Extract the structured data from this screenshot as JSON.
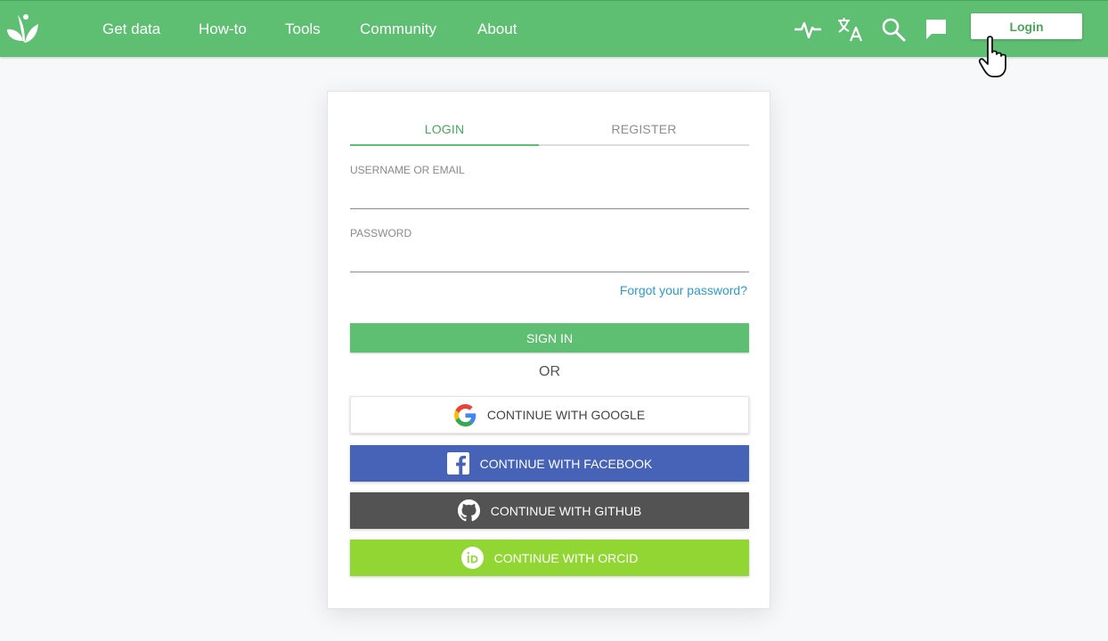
{
  "nav": {
    "items": [
      "Get data",
      "How-to",
      "Tools",
      "Community",
      "About"
    ],
    "login_label": "Login"
  },
  "icons": [
    "leaf-logo-icon",
    "activity-icon",
    "translate-icon",
    "search-icon",
    "feedback-icon"
  ],
  "colors": {
    "brand_green": "#5ebe72",
    "link_blue": "#2c9bd2",
    "facebook": "#4763b8",
    "github": "#535353",
    "orcid": "#92d633"
  },
  "form": {
    "tabs": [
      "LOGIN",
      "REGISTER"
    ],
    "active_tab": "LOGIN",
    "username_label": "USERNAME OR EMAIL",
    "username_value": "",
    "password_label": "PASSWORD",
    "password_value": "",
    "forgot": "Forgot your password?",
    "signin": "SIGN IN",
    "or": "OR",
    "google": "CONTINUE WITH GOOGLE",
    "facebook": "CONTINUE WITH FACEBOOK",
    "github": "CONTINUE WITH GITHUB",
    "orcid": "CONTINUE WITH ORCID"
  }
}
